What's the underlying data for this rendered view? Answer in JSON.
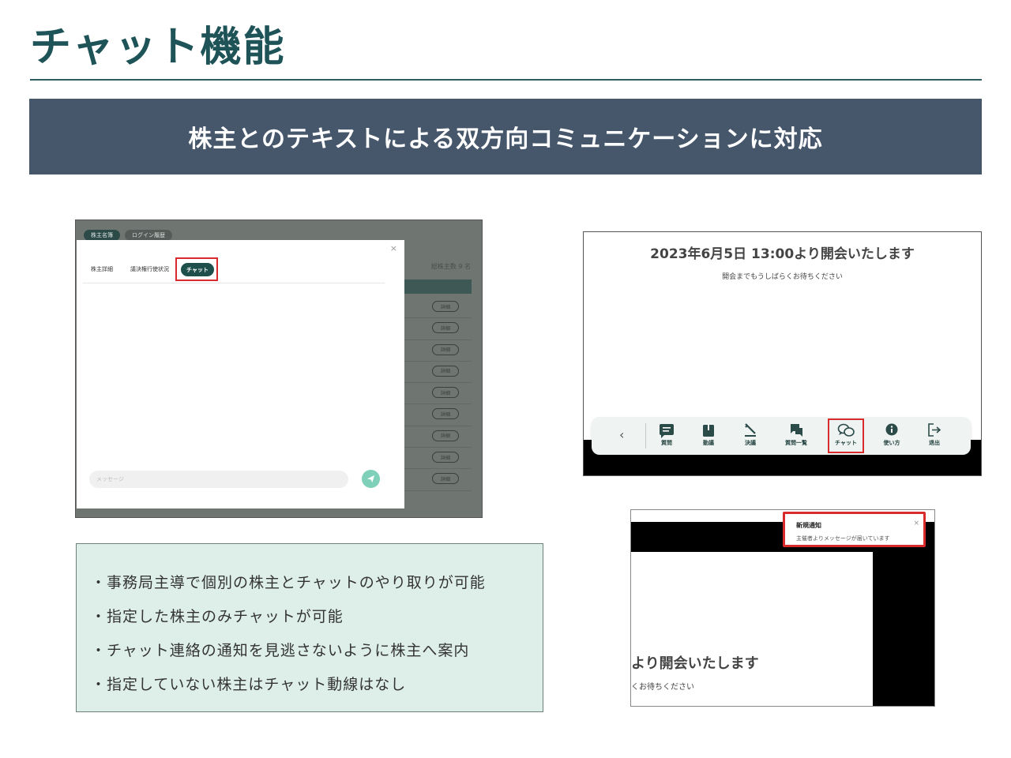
{
  "page": {
    "title": "チャット機能",
    "banner": "株主とのテキストによる双方向コミュニケーションに対応"
  },
  "admin_screen": {
    "bg_tabs": [
      "株主名簿",
      "ログイン履歴"
    ],
    "bg_count": "総株主数 9 名",
    "bg_row_button": "詳細",
    "bg_rows": 9,
    "modal": {
      "close": "×",
      "tabs": [
        "株主詳細",
        "議決権行使状況",
        "チャット"
      ],
      "active_tab": "チャット",
      "message_placeholder": "メッセージ",
      "send_icon": "send-icon"
    }
  },
  "meeting_screen": {
    "title": "2023年6月5日 13:00より開会いたします",
    "subtitle": "開会までもうしばらくお待ちください",
    "toolbar": {
      "back_icon": "chevron-left-icon",
      "items": [
        {
          "label": "質問",
          "icon": "comment-icon"
        },
        {
          "label": "動議",
          "icon": "motion-icon"
        },
        {
          "label": "決議",
          "icon": "gavel-icon"
        },
        {
          "label": "質問一覧",
          "icon": "chat-list-icon"
        },
        {
          "label": "チャット",
          "icon": "chat-bubbles-icon"
        },
        {
          "label": "使い方",
          "icon": "info-icon"
        },
        {
          "label": "退出",
          "icon": "logout-icon"
        }
      ],
      "highlighted": "チャット"
    }
  },
  "notification_screen": {
    "notification_title": "新規通知",
    "notification_body": "主催者よりメッセージが届いています",
    "close": "×",
    "partial_title": "より開会いたします",
    "partial_subtitle": "くお待ちください"
  },
  "features": [
    "・事務局主導で個別の株主とチャットのやり取りが可能",
    "・指定した株主のみチャットが可能",
    "・チャット連絡の通知を見逃さないように株主へ案内",
    "・指定していない株主はチャット動線はなし"
  ],
  "colors": {
    "title": "#1e5358",
    "banner": "#46566b",
    "highlight": "#d92b2b",
    "feature_bg": "#deefe9",
    "chat_pill": "#1f4f4b",
    "send_button": "#7fd0b8"
  }
}
